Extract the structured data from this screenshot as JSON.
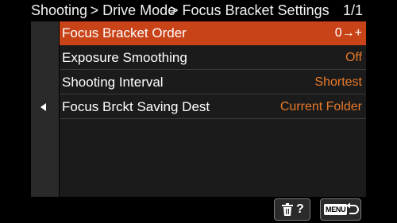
{
  "header": {
    "breadcrumb_1": "Shooting > Drive Mode",
    "breadcrumb_2": "> Focus Bracket Settings",
    "page": "1/1"
  },
  "menu": {
    "items": [
      {
        "label": "Focus Bracket Order",
        "value": "0→+",
        "selected": true
      },
      {
        "label": "Exposure Smoothing",
        "value": "Off",
        "selected": false
      },
      {
        "label": "Shooting Interval",
        "value": "Shortest",
        "selected": false
      },
      {
        "label": "Focus Brckt Saving Dest",
        "value": "Current Folder",
        "selected": false
      }
    ]
  },
  "footer": {
    "help_glyph": "?",
    "menu_badge": "MENU",
    "icons": [
      "trash-icon",
      "help-icon",
      "menu-icon",
      "return-icon"
    ]
  },
  "colors": {
    "selected_bg": "#c94318",
    "value_text": "#e87a29",
    "panel_bg": "#1b1b1b",
    "side_panel_bg": "#2a2a2a"
  }
}
